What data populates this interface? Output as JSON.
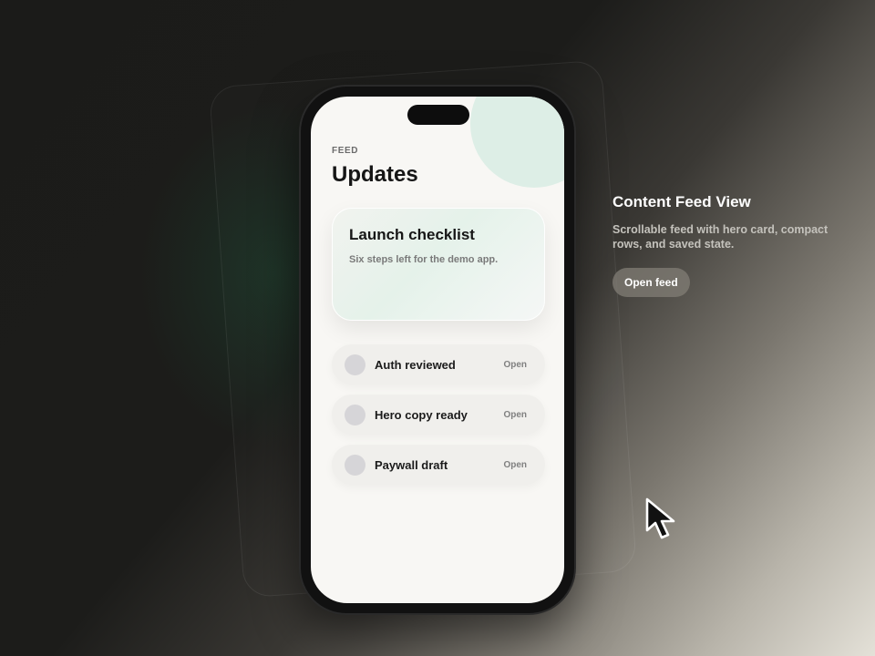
{
  "screen": {
    "eyebrow": "FEED",
    "title": "Updates",
    "hero": {
      "title": "Launch checklist",
      "subtitle": "Six steps left for the demo app."
    },
    "rows": [
      {
        "label": "Auth reviewed",
        "action": "Open"
      },
      {
        "label": "Hero copy ready",
        "action": "Open"
      },
      {
        "label": "Paywall draft",
        "action": "Open"
      }
    ]
  },
  "info": {
    "title": "Content Feed View",
    "description": "Scrollable feed with hero card, compact rows, and saved state.",
    "button_label": "Open feed"
  },
  "icons": {
    "cursor": "mouse-pointer-icon"
  },
  "colors": {
    "accent_mint": "#ddeee6",
    "screen_bg": "#f8f7f4",
    "phone_frame": "#111111"
  }
}
